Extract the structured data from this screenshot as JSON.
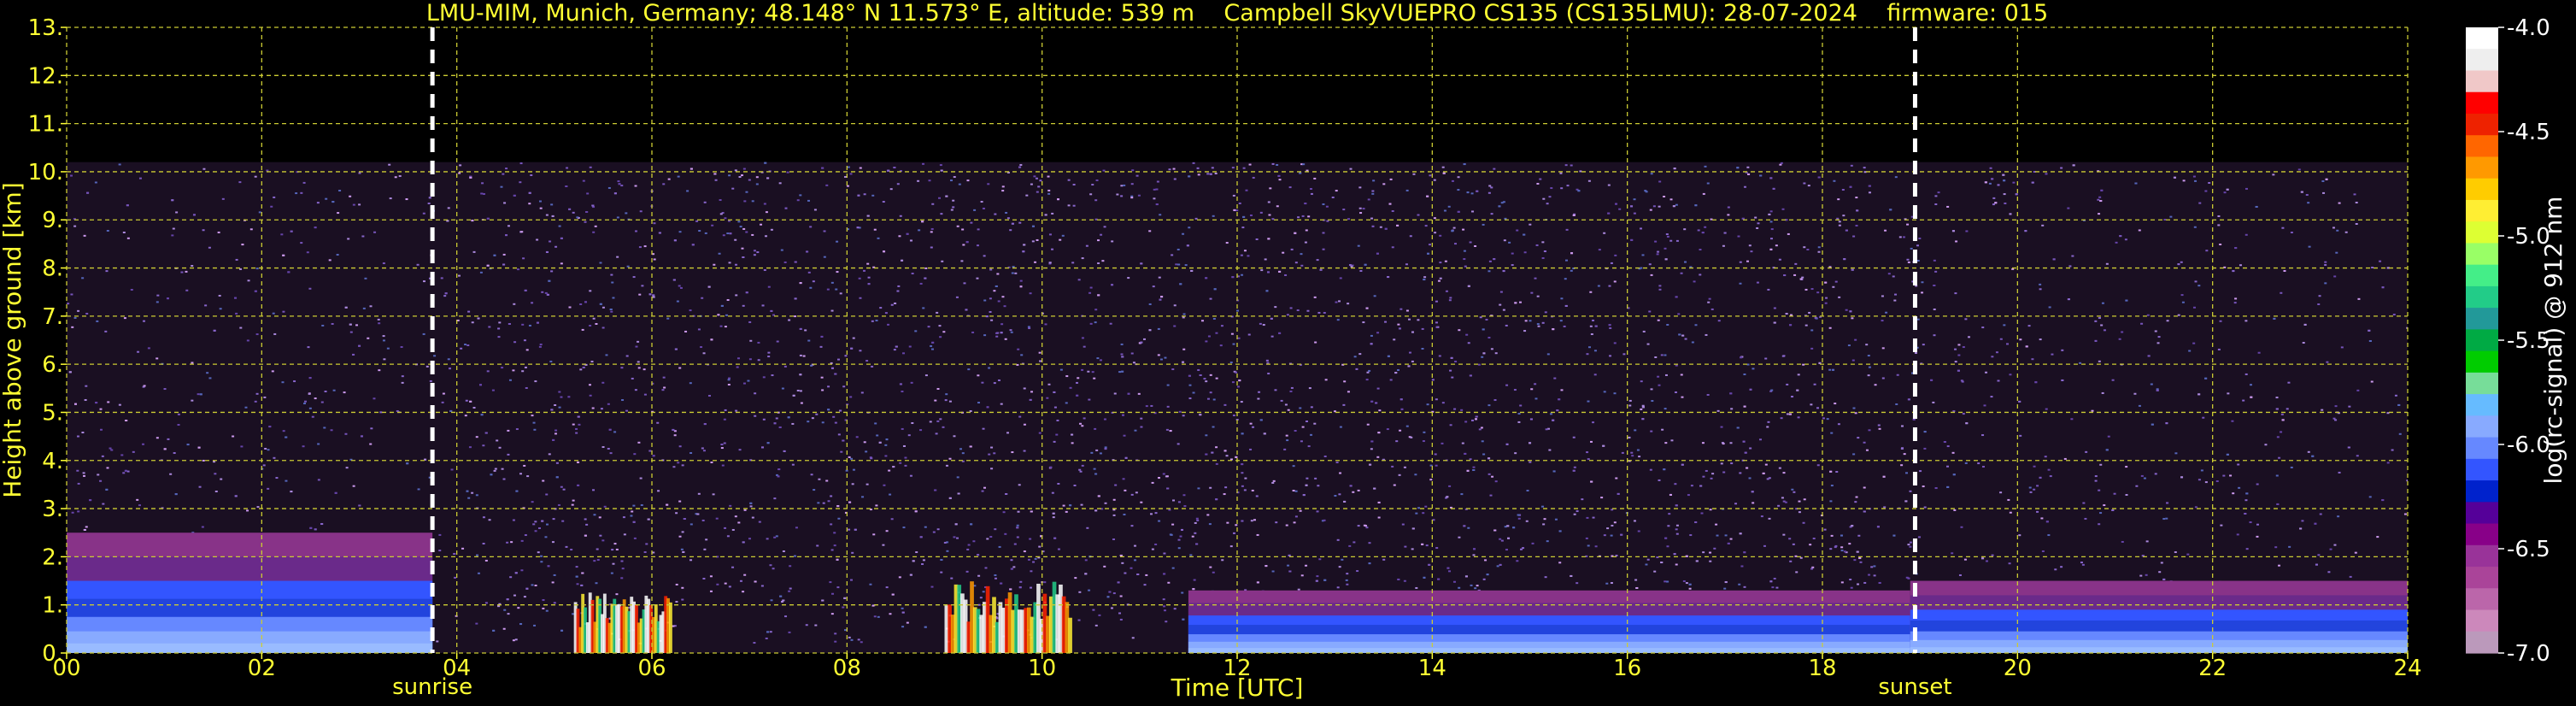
{
  "chart_data": {
    "type": "heatmap",
    "title": "LMU-MIM, Munich, Germany; 48.148° N 11.573° E, altitude: 539 m    Campbell SkyVUEPRO CS135 (CS135LMU): 28-07-2024    firmware: 015",
    "xlabel": "Time [UTC]",
    "ylabel": "Height above ground [km]",
    "xlim": [
      0,
      24
    ],
    "ylim": [
      0,
      13
    ],
    "x_ticks": [
      "00",
      "02",
      "04",
      "06",
      "08",
      "10",
      "12",
      "14",
      "16",
      "18",
      "20",
      "22",
      "24"
    ],
    "y_ticks": [
      "0.",
      "1.",
      "2.",
      "3.",
      "4.",
      "5.",
      "6.",
      "7.",
      "8.",
      "9.",
      "10.",
      "11.",
      "12.",
      "13."
    ],
    "grid": true,
    "events": [
      {
        "label": "sunrise",
        "time": 3.75
      },
      {
        "label": "sunset",
        "time": 18.95
      }
    ],
    "colorbar": {
      "label": "log(rc-signal) @ 912 nm",
      "range": [
        -7.0,
        -4.0
      ],
      "ticks": [
        "-4.0",
        "-4.5",
        "-5.0",
        "-5.5",
        "-6.0",
        "-6.5",
        "-7.0"
      ],
      "colors": [
        "#ffffff",
        "#eeeeee",
        "#f0c8c8",
        "#ff0000",
        "#ee2200",
        "#ff6600",
        "#ff9900",
        "#ffcc00",
        "#ffee33",
        "#ddff33",
        "#99ff66",
        "#44ee88",
        "#22cc88",
        "#229999",
        "#00aa44",
        "#00cc00",
        "#77dd99",
        "#66bbff",
        "#88aaff",
        "#6688ff",
        "#3355ff",
        "#0022cc",
        "#550099",
        "#880088",
        "#993399",
        "#aa4499",
        "#bb66aa",
        "#cc88bb",
        "#bb99bb"
      ]
    },
    "layers": [
      {
        "type": "clear_sky_noise",
        "t_start": 0,
        "t_end": 24,
        "h_max": 10.2
      },
      {
        "type": "boundary_layer",
        "t_start": 0,
        "t_end": 3.75,
        "h_top": 2.5
      },
      {
        "type": "boundary_layer",
        "t_start": 11.5,
        "t_end": 18.9,
        "h_top": 1.3
      },
      {
        "type": "boundary_layer",
        "t_start": 18.9,
        "t_end": 24,
        "h_top": 1.5
      },
      {
        "type": "low_cloud",
        "t_start": 5.2,
        "t_end": 6.2,
        "h_top": 1.3
      },
      {
        "type": "low_cloud",
        "t_start": 9.0,
        "t_end": 10.3,
        "h_top": 1.5
      }
    ]
  },
  "colors": {
    "background": "#000000",
    "text": "#ffff33",
    "grid": "#cccc33",
    "event_line": "#ffffff",
    "colorbar_label": "#ffffff"
  }
}
